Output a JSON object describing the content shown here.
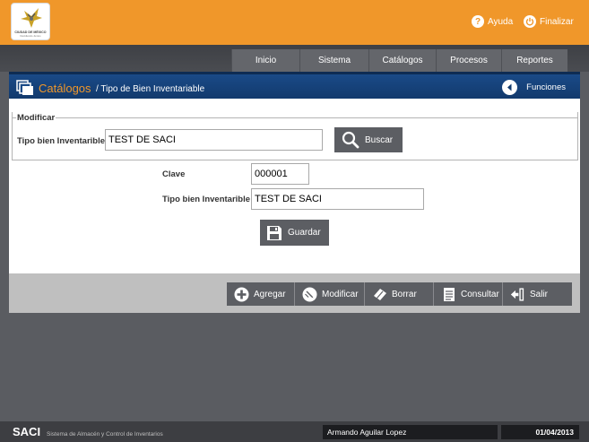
{
  "header": {
    "logo_text": "CIUDAD DE MÉXICO",
    "logo_sub": "Decidiendo Juntos",
    "help_label": "Ayuda",
    "exit_label": "Finalizar"
  },
  "menu": {
    "items": [
      {
        "label": "Inicio"
      },
      {
        "label": "Sistema"
      },
      {
        "label": "Catálogos"
      },
      {
        "label": "Procesos"
      },
      {
        "label": "Reportes"
      }
    ]
  },
  "titlebar": {
    "section": "Catálogos",
    "subtitle": "/ Tipo de Bien Inventariable",
    "functions_label": "Funciones"
  },
  "modify": {
    "legend": "Modificar",
    "field_label": "Tipo bien Inventarible",
    "field_value": "TEST DE SACI",
    "search_label": "Buscar"
  },
  "form": {
    "key_label": "Clave",
    "key_value": "000001",
    "type_label": "Tipo bien Inventarible",
    "type_value": "TEST DE SACI",
    "save_label": "Guardar"
  },
  "toolbar": {
    "add_label": "Agregar",
    "modify_label": "Modificar",
    "delete_label": "Borrar",
    "query_label": "Consultar",
    "exit_label": "Salir"
  },
  "footer": {
    "app_name": "SACI",
    "app_full_name": "Sistema de Almacén y Control de Inventarios",
    "user_name": "Armando Aguilar Lopez",
    "date": "01/04/2013"
  },
  "colors": {
    "header_orange": "#f0972a",
    "title_blue": "#1a4a87",
    "button_gray": "#5c5e63"
  }
}
